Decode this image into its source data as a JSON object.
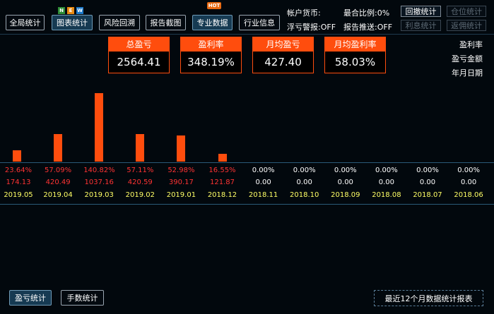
{
  "toolbar": {
    "buttons": [
      {
        "label": "全局统计",
        "active": false
      },
      {
        "label": "图表统计",
        "active": true
      },
      {
        "label": "风险回溯",
        "active": false
      },
      {
        "label": "报告截图",
        "active": false
      },
      {
        "label": "专业数据",
        "active": true
      },
      {
        "label": "行业信息",
        "active": false
      }
    ],
    "new_badge": [
      "N",
      "E",
      "W"
    ],
    "hot_badge": "HOT"
  },
  "account": {
    "currency_label": "帐户货币:",
    "position_ratio": "最合比例:0%",
    "float_alert": "浮亏警报:OFF",
    "report_push": "报告推送:OFF"
  },
  "side_buttons": {
    "backtest": "回撤统计",
    "position": "仓位统计",
    "interest": "利息统计",
    "rebate": "返佣统计"
  },
  "kpis": [
    {
      "label": "总盈亏",
      "value": "2564.41"
    },
    {
      "label": "盈利率",
      "value": "348.19%"
    },
    {
      "label": "月均盈亏",
      "value": "427.40"
    },
    {
      "label": "月均盈利率",
      "value": "58.03%"
    }
  ],
  "legend": {
    "rate": "盈利率",
    "amount": "盈亏金额",
    "date": "年月日期"
  },
  "colors": {
    "accent": "#ff4d0d",
    "positive_text": "#ff3333",
    "date_text": "#ffff66",
    "background": "#02080d"
  },
  "chart_data": {
    "type": "bar",
    "categories": [
      "2019.05",
      "2019.04",
      "2019.03",
      "2019.02",
      "2019.01",
      "2018.12",
      "2018.11",
      "2018.10",
      "2018.09",
      "2018.08",
      "2018.07",
      "2018.06"
    ],
    "series": [
      {
        "values": [
          23.64,
          57.09,
          140.82,
          57.11,
          52.98,
          16.55,
          0,
          0,
          0,
          0,
          0,
          0
        ]
      }
    ],
    "rate_labels": [
      "23.64%",
      "57.09%",
      "140.82%",
      "57.11%",
      "52.98%",
      "16.55%",
      "0.00%",
      "0.00%",
      "0.00%",
      "0.00%",
      "0.00%",
      "0.00%"
    ],
    "amount_labels": [
      "174.13",
      "420.49",
      "1037.16",
      "420.59",
      "390.17",
      "121.87",
      "0.00",
      "0.00",
      "0.00",
      "0.00",
      "0.00",
      "0.00"
    ],
    "ylim": [
      0,
      145
    ]
  },
  "footer": {
    "profit_stats": "盈亏统计",
    "lot_stats": "手数统计",
    "report": "最近12个月数据统计报表"
  }
}
